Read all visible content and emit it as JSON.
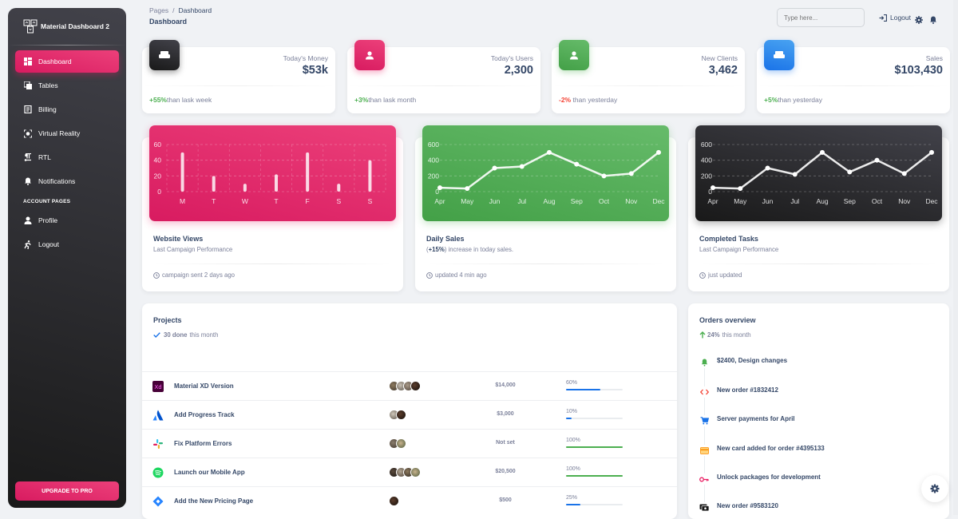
{
  "sidebar": {
    "brand": "Material Dashboard 2",
    "items": [
      {
        "label": "Dashboard",
        "icon": "dashboard-icon",
        "active": true
      },
      {
        "label": "Tables",
        "icon": "table-view-icon"
      },
      {
        "label": "Billing",
        "icon": "receipt-icon"
      },
      {
        "label": "Virtual Reality",
        "icon": "view-in-ar-icon"
      },
      {
        "label": "RTL",
        "icon": "format-textdirection-icon"
      }
    ],
    "notifications": {
      "label": "Notifications",
      "icon": "bell-icon"
    },
    "section": "ACCOUNT PAGES",
    "account_items": [
      {
        "label": "Profile",
        "icon": "person-icon"
      },
      {
        "label": "Logout",
        "icon": "exit-run-icon"
      }
    ],
    "upgrade": "UPGRADE TO PRO"
  },
  "topbar": {
    "breadcrumb_root": "Pages",
    "breadcrumb_sep": "/",
    "breadcrumb_current": "Dashboard",
    "page_title": "Dashboard",
    "search_placeholder": "Type here...",
    "logout": "Logout"
  },
  "stats": [
    {
      "label": "Today's Money",
      "value": "$53k",
      "change": "+55%",
      "change_text": "than lask week",
      "trend": "pos",
      "color": "#191919"
    },
    {
      "label": "Today's Users",
      "value": "2,300",
      "change": "+3%",
      "change_text": "than lask month",
      "trend": "pos",
      "color": "#e91e63"
    },
    {
      "label": "New Clients",
      "value": "3,462",
      "change": "-2%",
      "change_text": " than yesterday",
      "trend": "neg",
      "color": "#4caf50"
    },
    {
      "label": "Sales",
      "value": "$103,430",
      "change": "+5%",
      "change_text": "than yesterday",
      "trend": "pos",
      "color": "#1a73e8"
    }
  ],
  "charts": [
    {
      "title": "Website Views",
      "subtitle": "Last Campaign Performance",
      "footer": "campaign sent 2 days ago"
    },
    {
      "title": "Daily Sales",
      "subtitle_bold": "+15%",
      "subtitle_pre": "(",
      "subtitle_post": ") increase in today sales.",
      "footer": "updated 4 min ago"
    },
    {
      "title": "Completed Tasks",
      "subtitle": "Last Campaign Performance",
      "footer": "just updated"
    }
  ],
  "chart_data": [
    {
      "type": "bar",
      "title": "Website Views",
      "categories": [
        "M",
        "T",
        "W",
        "T",
        "F",
        "S",
        "S"
      ],
      "values": [
        50,
        20,
        10,
        22,
        50,
        10,
        40
      ],
      "yticks": [
        0,
        20,
        40,
        60
      ],
      "ylim": [
        0,
        60
      ],
      "grid": true,
      "xlabel": "",
      "ylabel": ""
    },
    {
      "type": "line",
      "title": "Daily Sales",
      "categories": [
        "Apr",
        "May",
        "Jun",
        "Jul",
        "Aug",
        "Sep",
        "Oct",
        "Nov",
        "Dec"
      ],
      "values": [
        50,
        40,
        300,
        320,
        500,
        350,
        200,
        230,
        500
      ],
      "yticks": [
        0,
        200,
        400,
        600
      ],
      "ylim": [
        0,
        600
      ],
      "grid": true,
      "xlabel": "",
      "ylabel": ""
    },
    {
      "type": "line",
      "title": "Completed Tasks",
      "categories": [
        "Apr",
        "May",
        "Jun",
        "Jul",
        "Aug",
        "Sep",
        "Oct",
        "Nov",
        "Dec"
      ],
      "values": [
        50,
        40,
        300,
        220,
        500,
        250,
        400,
        230,
        500
      ],
      "yticks": [
        0,
        200,
        400,
        600
      ],
      "ylim": [
        0,
        600
      ],
      "grid": true,
      "xlabel": "",
      "ylabel": ""
    }
  ],
  "projects": {
    "title": "Projects",
    "done_count": "30 done",
    "done_suffix": "this month",
    "rows": [
      {
        "name": "Material XD Version",
        "logo": "adobe-xd-logo",
        "members": 4,
        "budget": "$14,000",
        "completion": 60,
        "completion_label": "60%",
        "color": "#1a73e8"
      },
      {
        "name": "Add Progress Track",
        "logo": "atlassian-logo",
        "members": 2,
        "budget": "$3,000",
        "completion": 10,
        "completion_label": "10%",
        "color": "#1a73e8"
      },
      {
        "name": "Fix Platform Errors",
        "logo": "slack-logo",
        "members": 2,
        "budget": "Not set",
        "completion": 100,
        "completion_label": "100%",
        "color": "#4caf50"
      },
      {
        "name": "Launch our Mobile App",
        "logo": "spotify-logo",
        "members": 4,
        "budget": "$20,500",
        "completion": 100,
        "completion_label": "100%",
        "color": "#4caf50"
      },
      {
        "name": "Add the New Pricing Page",
        "logo": "jira-logo",
        "members": 1,
        "budget": "$500",
        "completion": 25,
        "completion_label": "25%",
        "color": "#1a73e8"
      }
    ]
  },
  "orders": {
    "title": "Orders overview",
    "growth": "24%",
    "growth_suffix": "this month",
    "items": [
      {
        "text": "$2400, Design changes",
        "icon": "bell-icon",
        "color": "#4caf50"
      },
      {
        "text": "New order #1832412",
        "icon": "code-icon",
        "color": "#f44335"
      },
      {
        "text": "Server payments for April",
        "icon": "cart-icon",
        "color": "#1a73e8"
      },
      {
        "text": "New card added for order #4395133",
        "icon": "credit-card-icon",
        "color": "#fb8c00"
      },
      {
        "text": "Unlock packages for development",
        "icon": "key-icon",
        "color": "#e91e63"
      },
      {
        "text": "New order #9583120",
        "icon": "payments-icon",
        "color": "#191919"
      }
    ]
  }
}
